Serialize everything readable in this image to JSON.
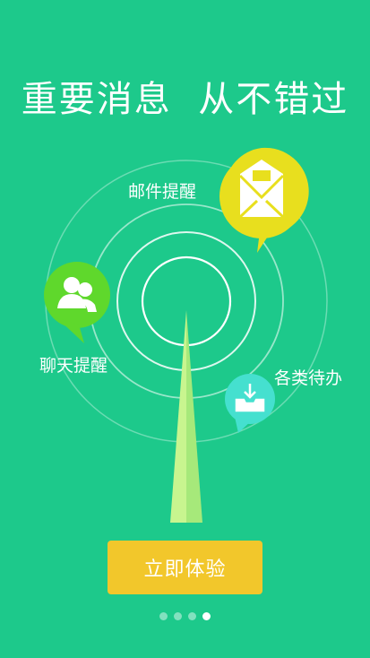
{
  "headline": "重要消息  从不错过",
  "features": {
    "mail": {
      "label": "邮件提醒",
      "icon": "mail-open-icon",
      "color": "#e8df1e"
    },
    "chat": {
      "label": "聊天提醒",
      "icon": "contacts-icon",
      "color": "#5fd82c"
    },
    "todo": {
      "label": "各类待办",
      "icon": "inbox-download-icon",
      "color": "#45e0cf"
    }
  },
  "cta": {
    "label": "立即体验",
    "color": "#f2c72b"
  },
  "pager": {
    "total": 4,
    "active_index": 3
  },
  "colors": {
    "background": "#1dc98b",
    "beam_light": "#c8f58f",
    "beam_dark": "#a6e97a"
  }
}
